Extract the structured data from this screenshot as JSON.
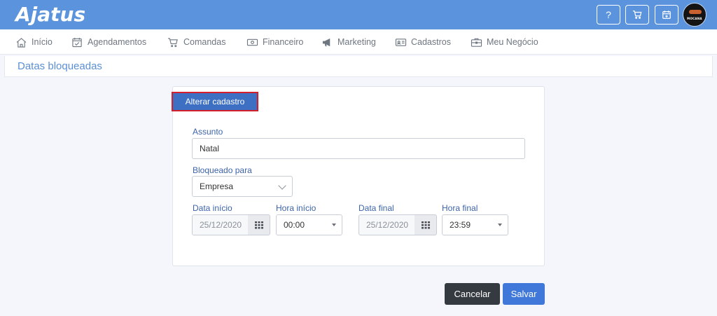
{
  "app": {
    "logo": "Ajatus"
  },
  "topbar": {
    "icons": [
      "help-icon",
      "cart-icon",
      "calendar-add-icon"
    ],
    "avatar_text": "MOCANA"
  },
  "nav": {
    "items": [
      {
        "label": "Início",
        "icon": "home-icon"
      },
      {
        "label": "Agendamentos",
        "icon": "calendar-check-icon"
      },
      {
        "label": "Comandas",
        "icon": "cart-icon"
      },
      {
        "label": "Financeiro",
        "icon": "money-icon"
      },
      {
        "label": "Marketing",
        "icon": "megaphone-icon"
      },
      {
        "label": "Cadastros",
        "icon": "id-card-icon"
      },
      {
        "label": "Meu Negócio",
        "icon": "briefcase-icon"
      }
    ]
  },
  "page": {
    "title": "Datas bloqueadas"
  },
  "form": {
    "tab_label": "Alterar cadastro",
    "assunto_label": "Assunto",
    "assunto_value": "Natal",
    "bloqueado_label": "Bloqueado para",
    "bloqueado_value": "Empresa",
    "data_inicio_label": "Data início",
    "data_inicio_value": "25/12/2020",
    "hora_inicio_label": "Hora início",
    "hora_inicio_value": "00:00",
    "data_final_label": "Data final",
    "data_final_value": "25/12/2020",
    "hora_final_label": "Hora final",
    "hora_final_value": "23:59"
  },
  "actions": {
    "cancel_label": "Cancelar",
    "save_label": "Salvar"
  },
  "colors": {
    "topbar": "#5b93dc",
    "primary": "#3f78d8",
    "tab": "#3d6fc2",
    "tab_border": "#d21f2b",
    "cancel": "#343a40"
  }
}
